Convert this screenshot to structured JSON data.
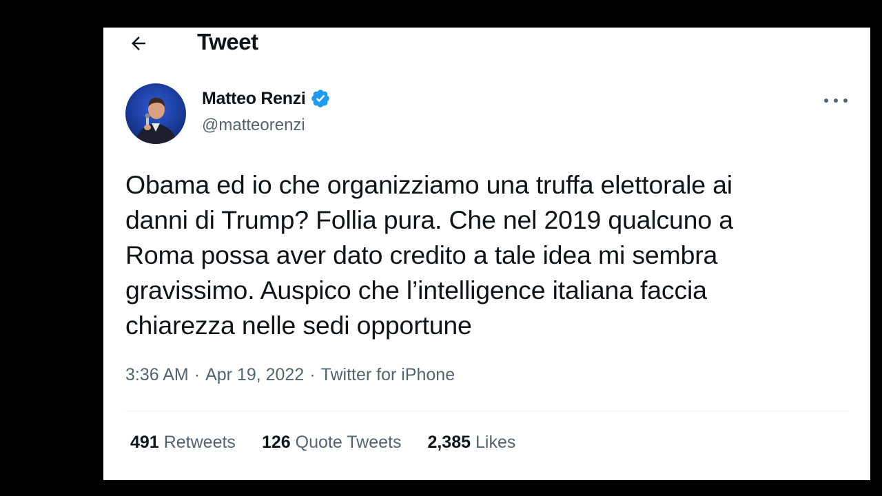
{
  "header": {
    "title": "Tweet",
    "back_icon": "arrow-left-icon"
  },
  "author": {
    "name": "Matteo Renzi",
    "handle": "@matteorenzi",
    "verified": true,
    "avatar_icon": "profile-photo"
  },
  "tweet": {
    "text": "Obama ed io che organizziamo una truffa elettorale ai\ndanni di Trump? Follia pura. Che nel 2019 qualcuno a\nRoma possa aver dato credito a tale idea mi sembra\ngravissimo. Auspico che l’intelligence italiana faccia\nchiarezza nelle sedi opportune",
    "time": "3:36 AM",
    "date": "Apr 19, 2022",
    "source": "Twitter for iPhone",
    "separator": "·"
  },
  "stats": [
    {
      "count": "491",
      "label": "Retweets"
    },
    {
      "count": "126",
      "label": "Quote Tweets"
    },
    {
      "count": "2,385",
      "label": "Likes"
    }
  ],
  "colors": {
    "text": "#0f1419",
    "secondary": "#536471",
    "verified": "#1d9bf0",
    "avatar_bg": "#1a3a8f"
  }
}
